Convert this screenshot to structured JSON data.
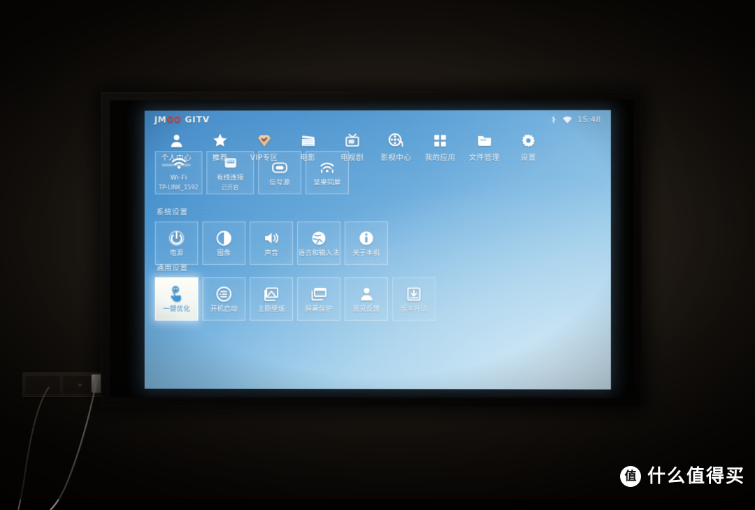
{
  "scene": {
    "description": "Dark room with wall-mounted projection screen showing a JMGO GITV Android TV settings home screen",
    "wall_outlet_label": "wall-outlet",
    "watermark": {
      "badge": "值",
      "text": "什么值得买"
    }
  },
  "statusbar": {
    "logo": {
      "part1": "JM",
      "part2": "GO",
      "part3": "GITV",
      "accent_color": "#e02b28"
    },
    "icons": [
      "bluetooth-icon",
      "wifi-icon"
    ],
    "time": "15:48"
  },
  "topnav": {
    "items": [
      {
        "label": "个人中心",
        "icon": "user-icon",
        "active": true
      },
      {
        "label": "推荐",
        "icon": "star-icon",
        "active": false
      },
      {
        "label": "VIP专区",
        "icon": "diamond-icon",
        "active": false
      },
      {
        "label": "电影",
        "icon": "clapboard-icon",
        "active": false
      },
      {
        "label": "电视剧",
        "icon": "tv-icon",
        "active": false
      },
      {
        "label": "影视中心",
        "icon": "film-reel-icon",
        "active": false
      },
      {
        "label": "我的应用",
        "icon": "apps-grid-icon",
        "active": false
      },
      {
        "label": "文件管理",
        "icon": "folder-icon",
        "active": false
      },
      {
        "label": "设置",
        "icon": "gear-icon",
        "active": false
      }
    ]
  },
  "sections": [
    {
      "id": "network",
      "title": "",
      "tiles": [
        {
          "label": "Wi-Fi",
          "sub": "TP-LINK_1592",
          "icon": "wifi-icon",
          "selected": false,
          "dim": false
        },
        {
          "label": "有线连接",
          "sub": "已开启",
          "icon": "ethernet-icon",
          "selected": false,
          "dim": false
        },
        {
          "label": "信号源",
          "sub": "",
          "icon": "hdmi-icon",
          "selected": false,
          "dim": false
        },
        {
          "label": "坚果同屏",
          "sub": "",
          "icon": "cast-icon",
          "selected": false,
          "dim": false
        }
      ]
    },
    {
      "id": "system",
      "title": "系统设置",
      "tiles": [
        {
          "label": "电源",
          "sub": "",
          "icon": "power-icon",
          "selected": false,
          "dim": false
        },
        {
          "label": "图像",
          "sub": "",
          "icon": "contrast-icon",
          "selected": false,
          "dim": false
        },
        {
          "label": "声音",
          "sub": "",
          "icon": "speaker-icon",
          "selected": false,
          "dim": false
        },
        {
          "label": "语言和输入法",
          "sub": "",
          "icon": "globe-icon",
          "selected": false,
          "dim": false
        },
        {
          "label": "关于本机",
          "sub": "",
          "icon": "info-icon",
          "selected": false,
          "dim": false
        }
      ]
    },
    {
      "id": "general",
      "title": "通用设置",
      "tiles": [
        {
          "label": "一键优化",
          "sub": "",
          "icon": "tap-hand-icon",
          "selected": true,
          "dim": false
        },
        {
          "label": "开机启动",
          "sub": "",
          "icon": "boot-list-icon",
          "selected": false,
          "dim": false
        },
        {
          "label": "主题壁纸",
          "sub": "",
          "icon": "wallpaper-icon",
          "selected": false,
          "dim": false
        },
        {
          "label": "屏幕保护",
          "sub": "",
          "icon": "screensaver-icon",
          "selected": false,
          "dim": false
        },
        {
          "label": "意见反馈",
          "sub": "",
          "icon": "person-icon",
          "selected": false,
          "dim": false
        },
        {
          "label": "版本升级",
          "sub": "",
          "icon": "upgrade-icon",
          "selected": false,
          "dim": true
        }
      ]
    }
  ]
}
